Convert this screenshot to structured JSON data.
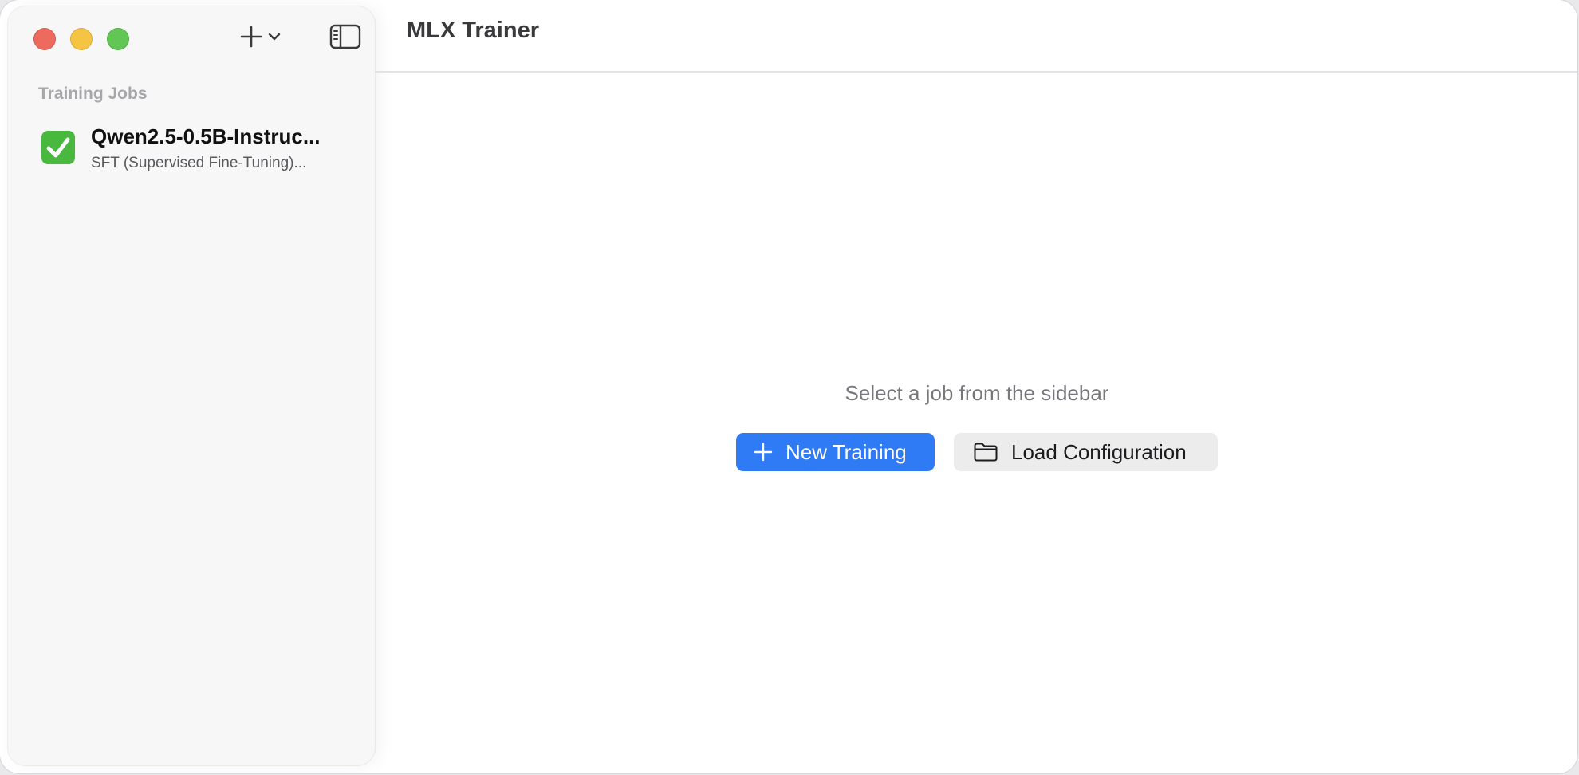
{
  "window": {
    "title": "MLX Trainer",
    "traffic_lights": {
      "close_color": "#ee6a5f",
      "minimize_color": "#f5c443",
      "maximize_color": "#62c655"
    }
  },
  "sidebar": {
    "add_menu_icon": "plus-icon",
    "add_menu_chevron": "chevron-down-icon",
    "toggle_icon": "sidebar-toggle-icon",
    "section_label": "Training Jobs",
    "jobs": [
      {
        "title": "Qwen2.5-0.5B-Instruc...",
        "subtitle": "SFT (Supervised Fine-Tuning)...",
        "status_icon": "check-icon",
        "status_color": "#49b83f"
      }
    ]
  },
  "main": {
    "empty_message": "Select a job from the sidebar",
    "new_training_label": "New Training",
    "new_training_icon": "plus-icon",
    "load_config_label": "Load Configuration",
    "load_config_icon": "folder-icon",
    "accent_color": "#2f7bf5"
  }
}
